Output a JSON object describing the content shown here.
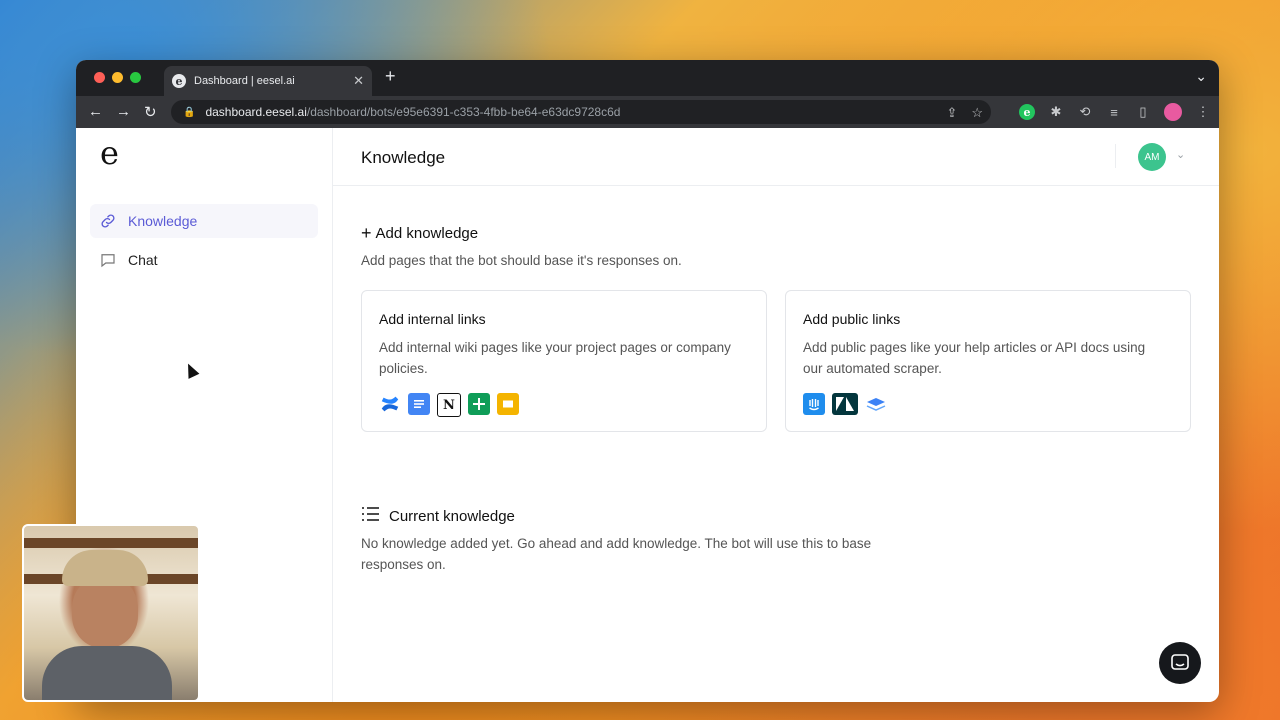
{
  "browser": {
    "tab_title": "Dashboard | eesel.ai",
    "tab_favicon": "e",
    "url_host": "dashboard.eesel.ai",
    "url_path": "/dashboard/bots/e95e6391-c353-4fbb-be64-e63dc9728c6d"
  },
  "sidebar": {
    "logo": "e",
    "items": [
      {
        "label": "Knowledge",
        "icon": "link-icon",
        "active": true
      },
      {
        "label": "Chat",
        "icon": "chat-bubble-icon",
        "active": false
      }
    ]
  },
  "header": {
    "title": "Knowledge",
    "avatar_initials": "AM",
    "avatar_color": "#3cc48e"
  },
  "add_knowledge": {
    "title": "Add knowledge",
    "subtitle": "Add pages that the bot should base it's responses on."
  },
  "cards": [
    {
      "title": "Add internal links",
      "description": "Add internal wiki pages like your project pages or company policies.",
      "icons": [
        "confluence-icon",
        "google-docs-icon",
        "notion-icon",
        "google-sheets-icon",
        "google-slides-icon"
      ]
    },
    {
      "title": "Add public links",
      "description": "Add public pages like your help articles or API docs using our automated scraper.",
      "icons": [
        "intercom-icon",
        "zendesk-icon",
        "document360-icon"
      ]
    }
  ],
  "current_knowledge": {
    "title": "Current knowledge",
    "empty_message": "No knowledge added yet. Go ahead and add knowledge. The bot will use this to base responses on."
  },
  "colors": {
    "accent": "#5b5bd6",
    "chat_fab": "#16181c"
  }
}
